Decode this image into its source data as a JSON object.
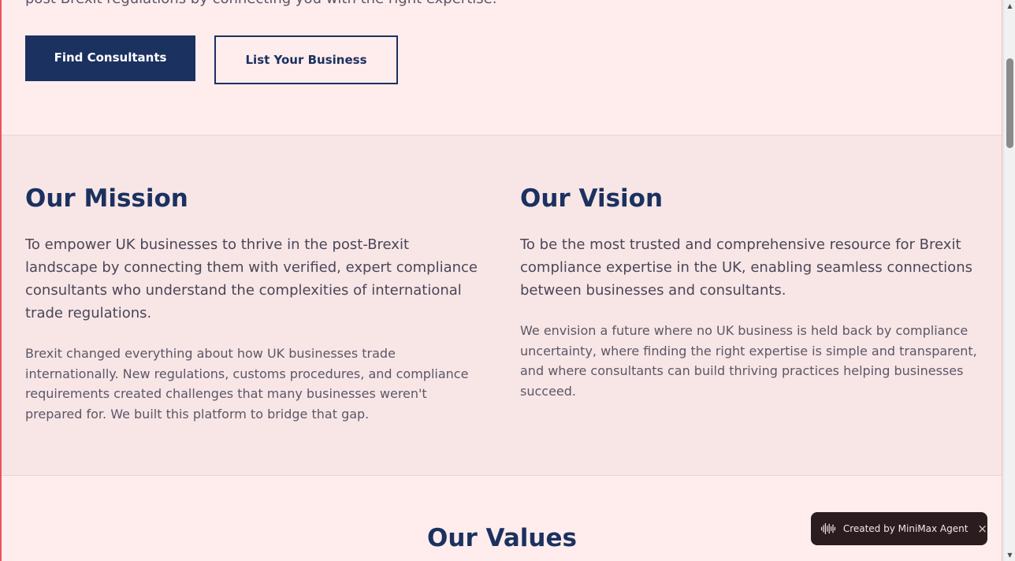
{
  "hero": {
    "text": "post-Brexit regulations by connecting you with the right expertise.",
    "primary_button": "Find Consultants",
    "secondary_button": "List Your Business"
  },
  "mission": {
    "title": "Our Mission",
    "lead": "To empower UK businesses to thrive in the post-Brexit landscape by connecting them with verified, expert compliance consultants who understand the complexities of international trade regulations.",
    "body": "Brexit changed everything about how UK businesses trade internationally. New regulations, customs procedures, and compliance requirements created challenges that many businesses weren't prepared for. We built this platform to bridge that gap."
  },
  "vision": {
    "title": "Our Vision",
    "lead": "To be the most trusted and comprehensive resource for Brexit compliance expertise in the UK, enabling seamless connections between businesses and consultants.",
    "body": "We envision a future where no UK business is held back by compliance uncertainty, where finding the right expertise is simple and transparent, and where consultants can build thriving practices helping businesses succeed."
  },
  "values": {
    "title": "Our Values"
  },
  "badge": {
    "icon": "waveform-icon",
    "text": "Created by MiniMax Agent",
    "close": "×"
  },
  "colors": {
    "primary": "#1b3160",
    "hero_bg": "#ffeded",
    "section_bg": "#f8e6e6",
    "badge_bg": "#2b1d1f"
  }
}
